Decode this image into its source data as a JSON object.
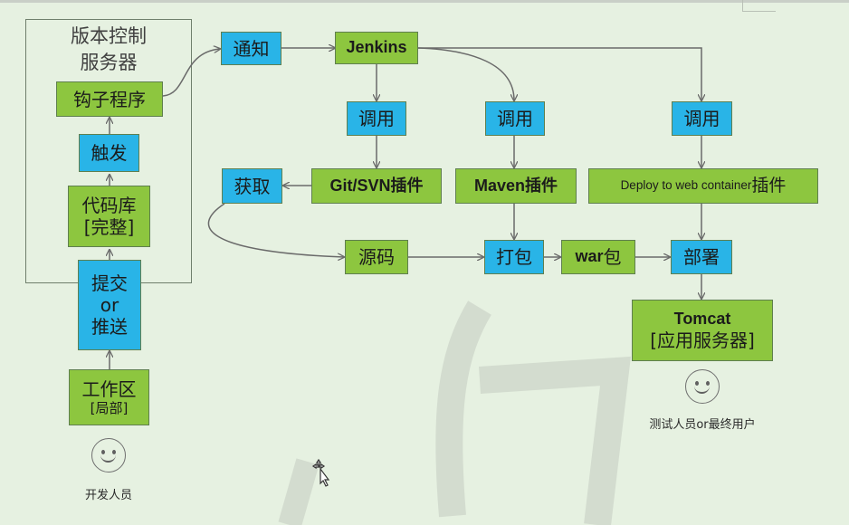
{
  "server_title": "版本控制\n服务器",
  "nodes": {
    "hook": "钩子程序",
    "trigger": "触发",
    "repo": "代码库\n[完整]",
    "commit": "提交\nor\n推送",
    "workspace_main": "工作区",
    "workspace_sub": "[局部]",
    "notify": "通知",
    "jenkins": "Jenkins",
    "call1": "调用",
    "call2": "调用",
    "call3": "调用",
    "fetch": "获取",
    "git_plugin": "Git/SVN插件",
    "maven_plugin": "Maven插件",
    "deploy_plugin_en": "Deploy to web container",
    "deploy_plugin_cn": "插件",
    "source": "源码",
    "package": "打包",
    "war_en": "war",
    "war_cn": "包",
    "deploy": "部署",
    "tomcat_main": "Tomcat",
    "tomcat_sub": "[应用服务器]"
  },
  "actors": {
    "developer": "开发人员",
    "tester_a": "测试人员",
    "tester_or": "or",
    "tester_b": "最终用户"
  },
  "icons": [
    "smiley-icon",
    "move-cursor-icon"
  ],
  "colors": {
    "green": "#8dc63f",
    "blue": "#29b4e7",
    "background": "#e6f1e1"
  }
}
